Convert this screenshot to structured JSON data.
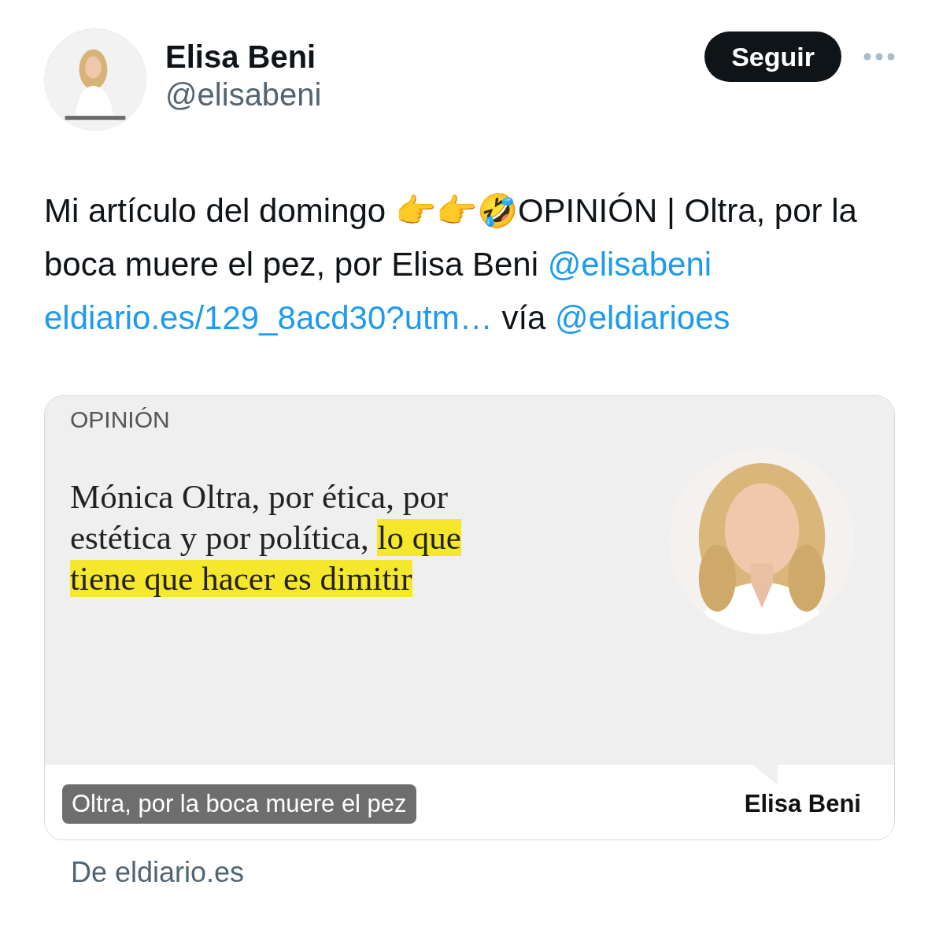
{
  "author": {
    "name": "Elisa Beni",
    "handle": "@elisabeni"
  },
  "follow_button": "Seguir",
  "tweet_text": [
    {
      "kind": "text",
      "text": "Mi artículo del domingo 👉👉🤣OPINIÓN | Oltra, por la boca muere el pez, por Elisa Beni"
    },
    {
      "kind": "link",
      "text": "@elisabeni"
    },
    {
      "kind": "link",
      "text": "eldiario.es/129_8acd30?utm…"
    },
    {
      "kind": "text",
      "text": "vía"
    },
    {
      "kind": "link",
      "text": "@eldiarioes"
    }
  ],
  "card": {
    "section": "OPINIÓN",
    "headline": [
      {
        "text": "Mónica Oltra, por ética, por estética y por política,",
        "highlighted": false
      },
      {
        "text": "lo que tiene que hacer es dimitir",
        "highlighted": true
      }
    ],
    "byline": "Elisa Beni",
    "caption": "Oltra, por la boca muere el pez"
  },
  "source": "De eldiario.es"
}
